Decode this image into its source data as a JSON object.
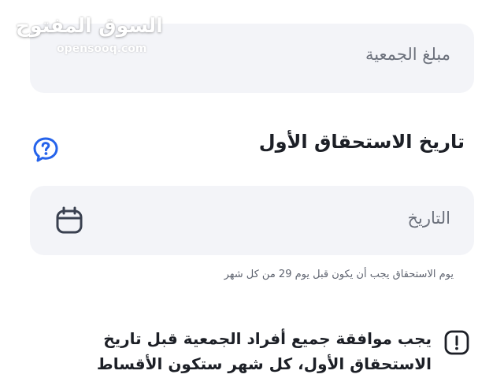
{
  "logo": {
    "arabic": "السوق المفتوح",
    "latin": "opensooq.com"
  },
  "amount_field": {
    "placeholder": "مبلغ الجمعية"
  },
  "due_date_section": {
    "title": "تاريخ الاستحقاق الأول",
    "help_icon": "help-chat-icon"
  },
  "date_field": {
    "placeholder": "التاريخ",
    "icon": "calendar-icon"
  },
  "hint": "يوم الاستحقاق يجب أن يكون قبل يوم 29 من كل شهر",
  "notice": {
    "icon": "warning-icon",
    "line1": "يجب موافقة جميع أفراد الجمعية قبل تاريخ",
    "line2": "الاستحقاق الأول، كل شهر ستكون الأقساط"
  },
  "colors": {
    "field_background": "#f3f4f8",
    "help_icon": "#2563eb",
    "text_primary": "#1c1f26",
    "text_secondary": "#6c717c"
  }
}
